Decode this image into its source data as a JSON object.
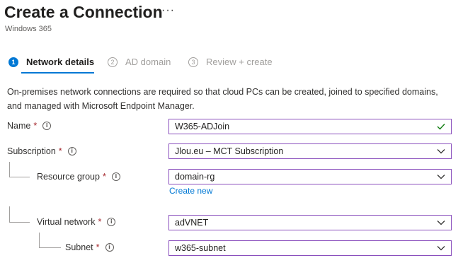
{
  "header": {
    "title": "Create a Connection",
    "more": "···",
    "subtitle": "Windows 365"
  },
  "steps": [
    {
      "number": "1",
      "label": "Network details",
      "state": "active"
    },
    {
      "number": "2",
      "label": "AD domain",
      "state": "inactive"
    },
    {
      "number": "3",
      "label": "Review + create",
      "state": "inactive"
    }
  ],
  "description": "On-premises network connections are required so that cloud PCs can be created, joined to specified domains, and managed with Microsoft Endpoint Manager.",
  "form": {
    "required_mark": "*",
    "info_glyph": "i",
    "name": {
      "label": "Name",
      "value": "W365-ADJoin",
      "valid_icon": "checkmark-icon"
    },
    "subscription": {
      "label": "Subscription",
      "value": "Jlou.eu – MCT Subscription"
    },
    "resource_group": {
      "label": "Resource group",
      "value": "domain-rg",
      "create_new": "Create new"
    },
    "virtual_network": {
      "label": "Virtual network",
      "value": "adVNET"
    },
    "subnet": {
      "label": "Subnet",
      "value": "w365-subnet"
    }
  },
  "colors": {
    "accent": "#0078d4",
    "field_border": "#8a4fbd",
    "required": "#a4262c",
    "valid": "#107c10"
  }
}
